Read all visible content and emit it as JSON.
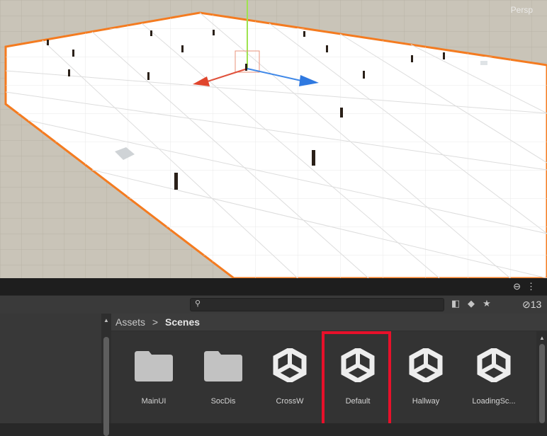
{
  "scene_view": {
    "camera_mode": "Persp",
    "colors": {
      "plane": "#ffffff",
      "border": "#f47b20",
      "ground": "#c9c4b8"
    }
  },
  "toolbar": {
    "lock_icon": "lock-icon",
    "more_icon": "more-icon",
    "search_placeholder": "",
    "hidden_count": "13"
  },
  "breadcrumb": {
    "root": "Assets",
    "separator": ">",
    "current": "Scenes"
  },
  "assets": [
    {
      "label": "MainUI",
      "type": "folder"
    },
    {
      "label": "SocDis",
      "type": "folder"
    },
    {
      "label": "CrossW",
      "type": "scene"
    },
    {
      "label": "Default",
      "type": "scene",
      "highlighted": true
    },
    {
      "label": "Hallway",
      "type": "scene"
    },
    {
      "label": "LoadingSc...",
      "type": "scene"
    }
  ],
  "highlight_color": "#e8102a"
}
